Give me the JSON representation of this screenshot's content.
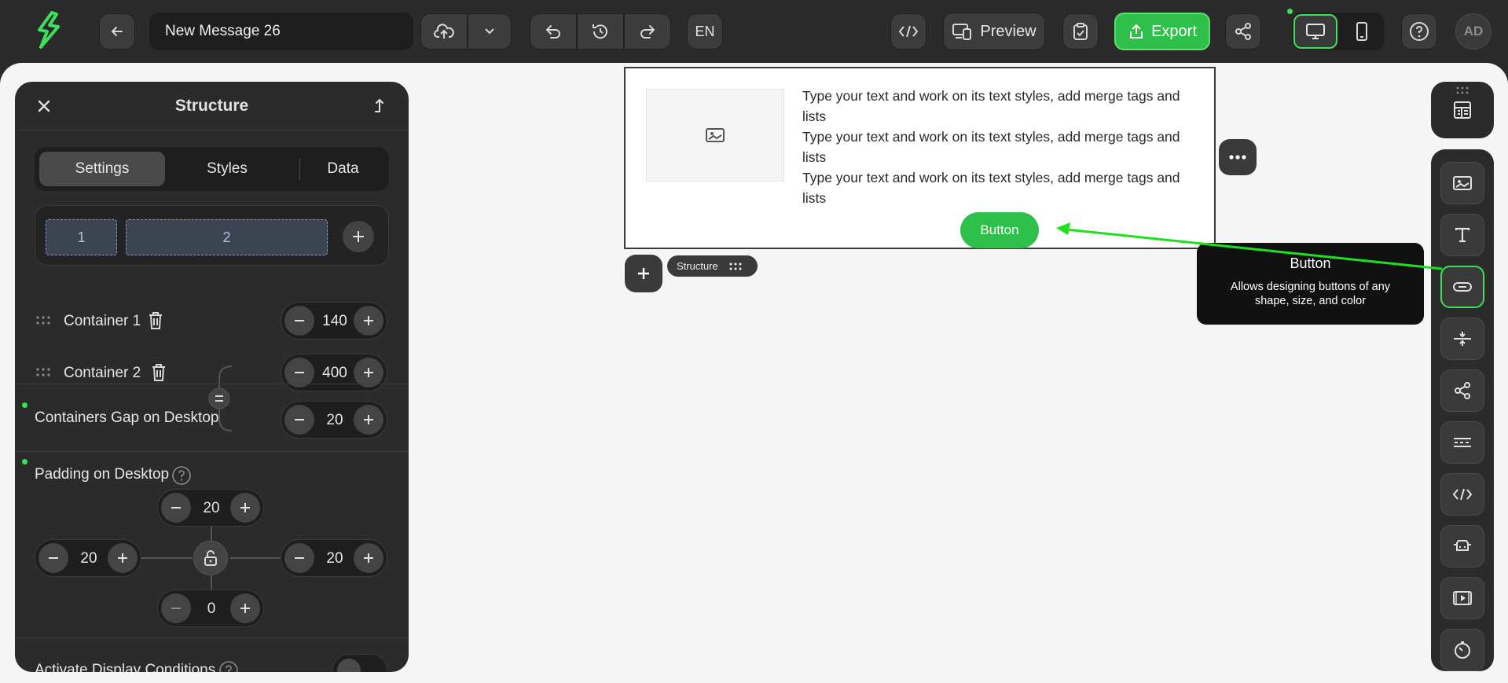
{
  "topbar": {
    "message_name": "New Message 26",
    "language": "EN",
    "preview_label": "Preview",
    "export_label": "Export",
    "avatar_initials": "AD"
  },
  "panel": {
    "title": "Structure",
    "tabs": [
      {
        "label": "Settings",
        "active": true
      },
      {
        "label": "Styles",
        "active": false
      },
      {
        "label": "Data",
        "active": false
      }
    ],
    "columns": [
      "1",
      "2"
    ],
    "containers": [
      {
        "label": "Container 1",
        "width": "140"
      },
      {
        "label": "Container 2",
        "width": "400"
      }
    ],
    "gap": {
      "label": "Containers Gap on Desktop",
      "value": "20"
    },
    "padding": {
      "label": "Padding on Desktop",
      "top": "20",
      "left": "20",
      "right": "20",
      "bottom": "0"
    },
    "display_conditions": {
      "label": "Activate Display Conditions",
      "enabled": false
    }
  },
  "email": {
    "text_lines": [
      "Type your text and work on its text styles, add merge tags and lists",
      "Type your text and work on its text styles, add merge tags and lists",
      "Type your text and work on its text styles, add merge tags and lists"
    ],
    "button_label": "Button",
    "structure_tag": "Structure"
  },
  "tooltip": {
    "title": "Button",
    "description": "Allows designing buttons of any shape, size, and color"
  },
  "toolbar_items": [
    "image-block",
    "text-block",
    "button-block",
    "spacer-block",
    "social-block",
    "menu-block",
    "html-block",
    "amp-carousel-block",
    "video-block",
    "timer-block"
  ],
  "colors": {
    "accent": "#2ec04a",
    "dark_bg": "#2b2b2b",
    "canvas_bg": "#f5f5f5"
  }
}
